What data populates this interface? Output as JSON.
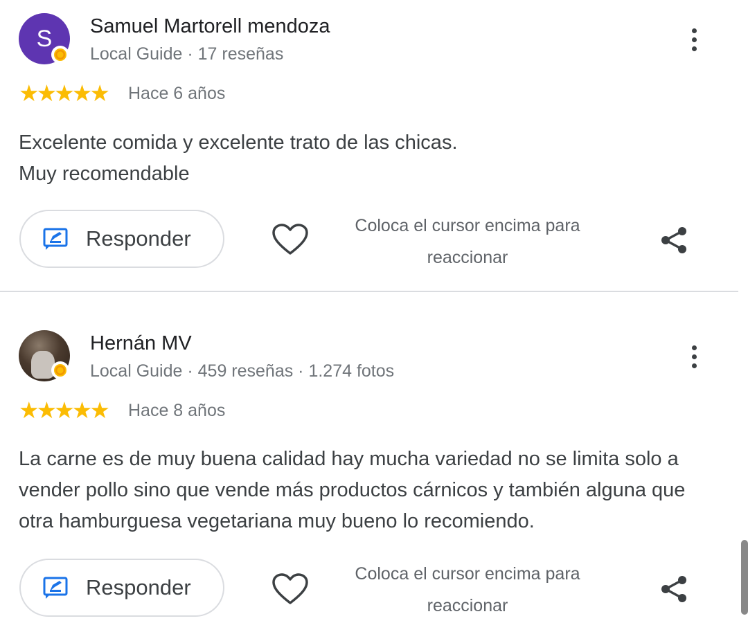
{
  "reviews": [
    {
      "avatar_letter": "S",
      "avatar_color": "#5e35b1",
      "name": "Samuel Martorell mendoza",
      "meta": "Local Guide · 17 reseñas",
      "rating": 5,
      "stars": "★★★★★",
      "date": "Hace 6 años",
      "text": [
        "Excelente comida y excelente trato de las chicas.",
        "Muy recomendable"
      ],
      "reply_label": "Responder",
      "react_text": "Coloca el cursor encima para reaccionar"
    },
    {
      "avatar_letter": "",
      "name": "Hernán MV",
      "meta": "Local Guide · 459 reseñas · 1.274 fotos",
      "rating": 5,
      "stars": "★★★★★",
      "date": "Hace 8 años",
      "text": [
        "La carne es de muy buena calidad hay mucha variedad no se limita solo a vender pollo sino que vende más productos cárnicos y también alguna que otra hamburguesa vegetariana muy bueno lo recomiendo."
      ],
      "reply_label": "Responder",
      "react_text": "Coloca el cursor encima para reaccionar"
    }
  ],
  "colors": {
    "star": "#fbbc04",
    "reply_icon": "#1a73e8",
    "divider": "#dadce0"
  },
  "icons": {
    "more": "more-vert-icon",
    "reply": "reply-icon",
    "heart": "heart-outline-icon",
    "share": "share-icon",
    "badge": "local-guide-badge-icon"
  }
}
